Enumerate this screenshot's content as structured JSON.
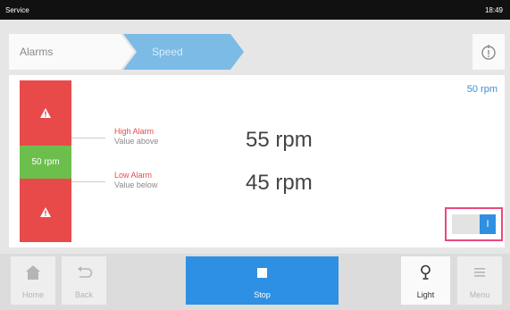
{
  "status_bar": {
    "title": "Service",
    "time": "18:49"
  },
  "breadcrumb": {
    "items": [
      "Alarms",
      "Speed"
    ]
  },
  "help_icon": "info-circle-icon",
  "setpoint": "50 rpm",
  "gauge": {
    "current_label": "50 rpm",
    "high_icon": "warning-icon",
    "low_icon": "warning-icon"
  },
  "high_alarm": {
    "title": "High Alarm",
    "subtitle": "Value above",
    "value": "55 rpm"
  },
  "low_alarm": {
    "title": "Low Alarm",
    "subtitle": "Value below",
    "value": "45 rpm"
  },
  "toggle": {
    "state": "on",
    "knob_label": "I"
  },
  "nav": [
    {
      "label": "Home",
      "icon": "home-icon"
    },
    {
      "label": "Back",
      "icon": "back-arrow-icon"
    },
    {
      "label": "Stop",
      "icon": "stop-icon"
    },
    {
      "label": "Light",
      "icon": "lightbulb-icon"
    },
    {
      "label": "Menu",
      "icon": "hamburger-menu-icon"
    }
  ],
  "colors": {
    "alarm_red": "#e84a4a",
    "ok_green": "#6dbf4d",
    "accent_blue": "#2e90e2",
    "highlight_pink": "#e84a7a"
  }
}
